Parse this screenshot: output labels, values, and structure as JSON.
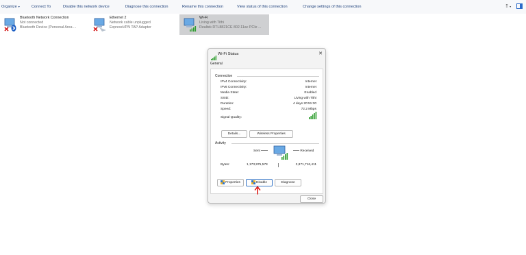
{
  "toolbar": {
    "organize": "Organize",
    "connect_to": "Connect To",
    "disable_device": "Disable this network device",
    "diagnose": "Diagnose this connection",
    "rename": "Rename this connection",
    "view_status": "View status of this connection",
    "change_settings": "Change settings of this connection"
  },
  "connections": [
    {
      "name": "Bluetooth Network Connection",
      "status": "Not connected",
      "device": "Bluetooth Device (Personal Area ..."
    },
    {
      "name": "Ethernet 2",
      "status": "Network cable unplugged",
      "device": "ExpressVPN TAP Adapter"
    },
    {
      "name": "Wi-Fi",
      "status": "Living with Tithi",
      "device": "Realtek RTL8821CE 802.11ac PCIe ..."
    }
  ],
  "dialog": {
    "title": "Wi-Fi Status",
    "close_glyph": "✕",
    "tab": "General",
    "connection": {
      "heading": "Connection",
      "rows": [
        {
          "label": "IPv4 Connectivity:",
          "value": "Internet"
        },
        {
          "label": "IPv6 Connectivity:",
          "value": "Internet"
        },
        {
          "label": "Media State:",
          "value": "Enabled"
        },
        {
          "label": "SSID:",
          "value": "Living with Tithi"
        },
        {
          "label": "Duration:",
          "value": "4 days 20:51:30"
        },
        {
          "label": "Speed:",
          "value": "72.2 Mbps"
        }
      ],
      "signal_label": "Signal Quality:",
      "signal_bars": 5,
      "details_button": "Details...",
      "wireless_button": "Wireless Properties"
    },
    "activity": {
      "heading": "Activity",
      "sent_label": "Sent",
      "received_label": "Received",
      "bytes_label": "Bytes:",
      "bytes_sent": "1,173,975,578",
      "bytes_received": "2,871,716,411"
    },
    "buttons": {
      "properties": "Properties",
      "disable": "Disable",
      "diagnose": "Diagnose",
      "close": "Close"
    }
  },
  "colors": {
    "accent_link": "#1c3f7a",
    "signal_green": "#2e9d2e",
    "annotation_red": "#e0201b"
  }
}
